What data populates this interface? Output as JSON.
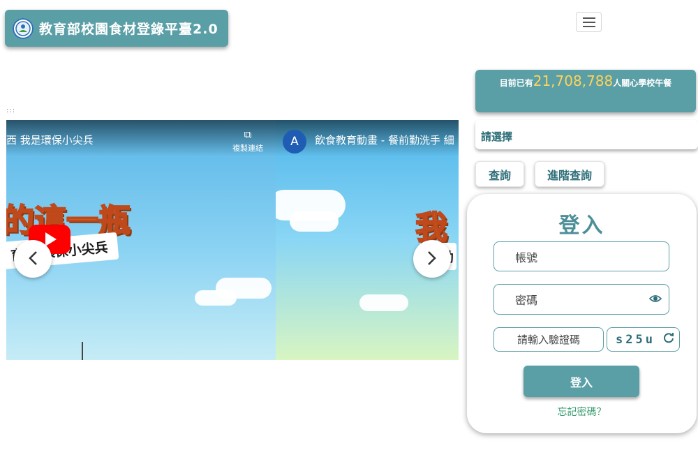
{
  "header": {
    "title": "教育部校園食材登錄平臺2.0",
    "logo_icon": "moe-emblem-icon",
    "menu_icon": "hamburger-menu-icon"
  },
  "skip_link": ":::",
  "carousel": {
    "slides": [
      {
        "video_title": "西 我是環保小尖兵",
        "copy_link_label": "複製連結",
        "art_big": "的這一瓶",
        "art_banner": "育  是環保小尖兵"
      },
      {
        "channel_initial": "A",
        "video_title": "飲食教育動畫 - 餐前勤洗手 細",
        "art_big": "我",
        "art_banner": "勸"
      }
    ],
    "prev_label": "‹",
    "next_label": "›"
  },
  "counter": {
    "prefix": "目前已有",
    "number": "21,708,788",
    "suffix": "人關心學校午餐"
  },
  "select": {
    "label": "請選擇"
  },
  "query": {
    "search": "查詢",
    "advanced": "進階查詢"
  },
  "login": {
    "title": "登入",
    "account_placeholder": "帳號",
    "password_placeholder": "密碼",
    "captcha_placeholder": "請輸入驗證碼",
    "captcha_code": "s25u",
    "submit": "登入",
    "forgot": "忘記密碼？"
  },
  "colors": {
    "primary": "#5a9ea6",
    "accent_number": "#ffd35a",
    "text_teal": "#2c6d78",
    "link_green": "#3a9b6e"
  }
}
